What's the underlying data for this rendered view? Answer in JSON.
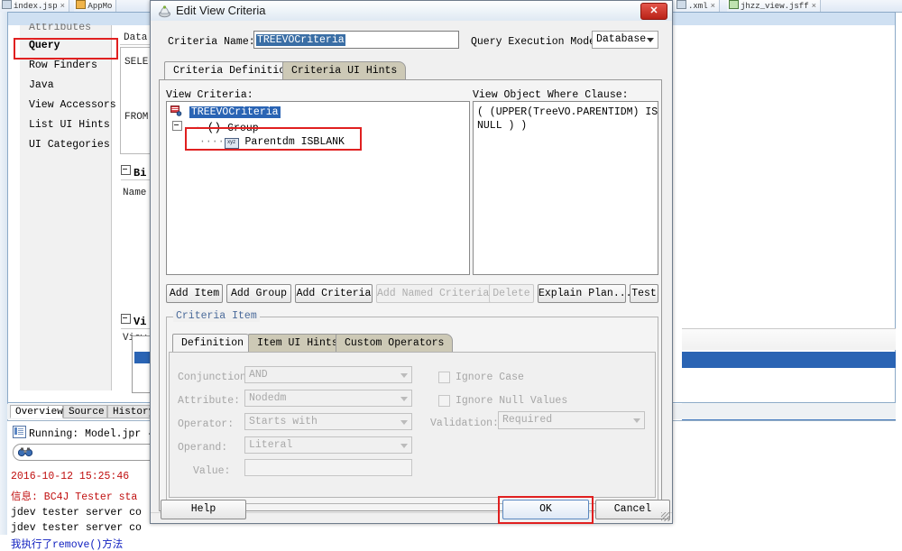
{
  "ide": {
    "tabs_left": [
      {
        "label": "index.jsp",
        "icon": "jsp-file-icon",
        "close": "×"
      },
      {
        "label": "AppMo",
        "icon": "module-file-icon",
        "close": ""
      }
    ],
    "tabs_right": [
      {
        "label": ".xml",
        "icon": "xml-file-icon",
        "close": "×"
      },
      {
        "label": "jhzz_view.jsff",
        "icon": "jsff-file-icon",
        "close": "×"
      }
    ],
    "structure_items": [
      {
        "label": "Attributes",
        "state": "clipped"
      },
      {
        "label": "Query",
        "state": "selected"
      },
      {
        "label": "Row Finders",
        "state": "normal"
      },
      {
        "label": "Java",
        "state": "normal"
      },
      {
        "label": "View Accessors",
        "state": "normal"
      },
      {
        "label": "List UI Hints",
        "state": "normal"
      },
      {
        "label": "UI Categories",
        "state": "normal"
      }
    ],
    "editor": {
      "datasource_label": "Data",
      "select_keyword": "SELE",
      "from_keyword": "FROM",
      "bind_section": "Bi",
      "bind_name_label": "Name",
      "view_section": "Vi",
      "view_criteria_label": "View"
    },
    "bottom_tabs": [
      {
        "label": "Overview",
        "active": true
      },
      {
        "label": "Source",
        "active": false
      },
      {
        "label": "History",
        "active": false
      }
    ],
    "log": {
      "running": "Running: Model.jpr -",
      "search_icon": "binoculars-icon",
      "lines": [
        {
          "text": "2016-10-12 15:25:46 ",
          "color": "red"
        },
        {
          "text": "信息: BC4J Tester sta",
          "color": "red"
        },
        {
          "text": "jdev tester server co",
          "color": "black"
        },
        {
          "text": "jdev tester server co",
          "color": "black"
        },
        {
          "text": "我执行了remove()方法",
          "color": "blue"
        }
      ]
    }
  },
  "dialog": {
    "title": "Edit View Criteria",
    "title_icon": "jdev-app-icon",
    "close_label": "✕",
    "criteria_name_label": "Criteria Name:",
    "criteria_name_value": "TREEVOCriteria",
    "query_exec_label": "Query Execution Mode:",
    "query_exec_value": "Database",
    "tabs": [
      {
        "label": "Criteria Definition",
        "active": true
      },
      {
        "label": "Criteria UI Hints",
        "active": false
      }
    ],
    "view_criteria_label": "View Criteria:",
    "where_clause_label": "View Object Where Clause:",
    "where_clause_text": "( (UPPER(TreeVO.PARENTIDM) IS\nNULL ) )",
    "tree": [
      {
        "label": "TREEVOCriteria",
        "icon": "view-criteria-icon",
        "selected": true,
        "indent": 0
      },
      {
        "label": "Group",
        "prefix": "()",
        "icon": "group-icon",
        "selected": false,
        "indent": 1
      },
      {
        "label": "Parentdm ISBLANK",
        "icon": "xyz-attribute-icon",
        "selected": false,
        "indent": 2,
        "highlighted": true
      }
    ],
    "action_buttons": [
      {
        "label": "Add Item",
        "enabled": true
      },
      {
        "label": "Add Group",
        "enabled": true
      },
      {
        "label": "Add Criteria",
        "enabled": true
      },
      {
        "label": "Add Named Criteria...",
        "enabled": false
      },
      {
        "label": "Delete",
        "enabled": false
      },
      {
        "label": "Explain Plan...",
        "enabled": true
      },
      {
        "label": "Test",
        "enabled": true
      }
    ],
    "criteria_item_group": "Criteria Item",
    "item_tabs": [
      {
        "label": "Definition",
        "active": true
      },
      {
        "label": "Item UI Hints",
        "active": false
      },
      {
        "label": "Custom Operators",
        "active": false
      }
    ],
    "fields": [
      {
        "label": "Conjunction:",
        "value": "AND",
        "enabled": false
      },
      {
        "label": "Attribute:",
        "value": "Nodedm",
        "enabled": false
      },
      {
        "label": "Operator:",
        "value": "Starts with",
        "enabled": false
      },
      {
        "label": "Operand:",
        "value": "Literal",
        "enabled": false
      }
    ],
    "value_label": "Value:",
    "value_text": "",
    "checkboxes": [
      {
        "label": "Ignore Case",
        "checked": false,
        "enabled": false
      },
      {
        "label": "Ignore Null Values",
        "checked": false,
        "enabled": false
      }
    ],
    "validation_label": "Validation:",
    "validation_value": "Required",
    "footer": {
      "help": "Help",
      "ok": "OK",
      "cancel": "Cancel"
    }
  },
  "colors": {
    "accent_blue": "#2a64b4",
    "highlight_red": "#e02020",
    "tab_inactive": "#cdc9b6",
    "selection_blue": "#3a6ea5"
  }
}
